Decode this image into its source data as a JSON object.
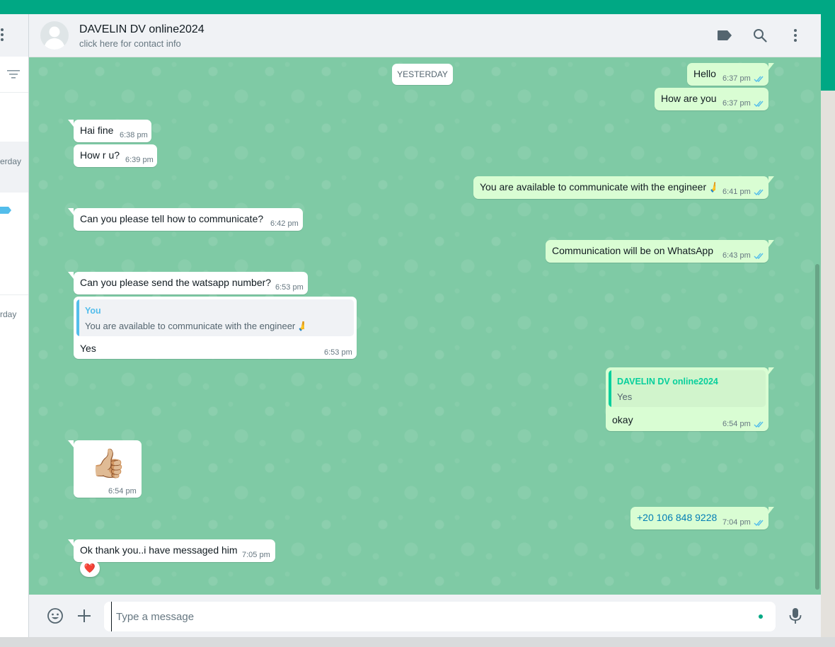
{
  "colors": {
    "accent": "#00a884",
    "chat_background": "#7fcaa5",
    "incoming_bubble": "#ffffff",
    "outgoing_bubble": "#d9fdd3",
    "read_ticks": "#53bdeb",
    "reply_you": "#53bdeb",
    "reply_contact": "#06cf9c",
    "reaction_heart": "#e0245e"
  },
  "sidebar": {
    "time_1": "erday",
    "time_2": "rday"
  },
  "header": {
    "contact_name": "DAVELIN DV online2024",
    "subtitle": "click here for contact info",
    "icons": [
      "label-icon",
      "search-icon",
      "menu-icon"
    ]
  },
  "chat": {
    "date_divider": "YESTERDAY",
    "messages": [
      {
        "dir": "out",
        "text": "Hello",
        "time": "6:37 pm",
        "status": "read"
      },
      {
        "dir": "out",
        "text": "How are you",
        "time": "6:37 pm",
        "status": "read"
      },
      {
        "dir": "in",
        "text": "Hai fine",
        "time": "6:38 pm"
      },
      {
        "dir": "in",
        "text": "How r u?",
        "time": "6:39 pm"
      },
      {
        "dir": "out",
        "text": "You are available to communicate with the engineer 🙏",
        "time": "6:41 pm",
        "status": "read"
      },
      {
        "dir": "in",
        "text": "Can you please tell how to communicate?",
        "time": "6:42 pm"
      },
      {
        "dir": "out",
        "text": "Communication will be on WhatsApp",
        "time": "6:43 pm",
        "status": "read"
      },
      {
        "dir": "in",
        "text": "Can you please send the watsapp number?",
        "time": "6:53 pm"
      },
      {
        "dir": "in",
        "text": "Yes",
        "time": "6:53 pm",
        "reply": {
          "name": "You",
          "text": "You are available to communicate with the engineer 🙏"
        }
      },
      {
        "dir": "out",
        "text": "okay",
        "time": "6:54 pm",
        "status": "read",
        "reply": {
          "name": "DAVELIN DV online2024",
          "text": "Yes"
        }
      },
      {
        "dir": "in",
        "text": "👍🏼",
        "time": "6:54 pm",
        "sticker": true
      },
      {
        "dir": "out",
        "text": "+20 106 848 9228",
        "time": "7:04 pm",
        "status": "read",
        "is_link": true
      },
      {
        "dir": "in",
        "text": "Ok thank you..i have messaged him",
        "time": "7:05 pm",
        "reaction": "❤️"
      }
    ]
  },
  "composer": {
    "placeholder": "Type a message",
    "value": ""
  }
}
